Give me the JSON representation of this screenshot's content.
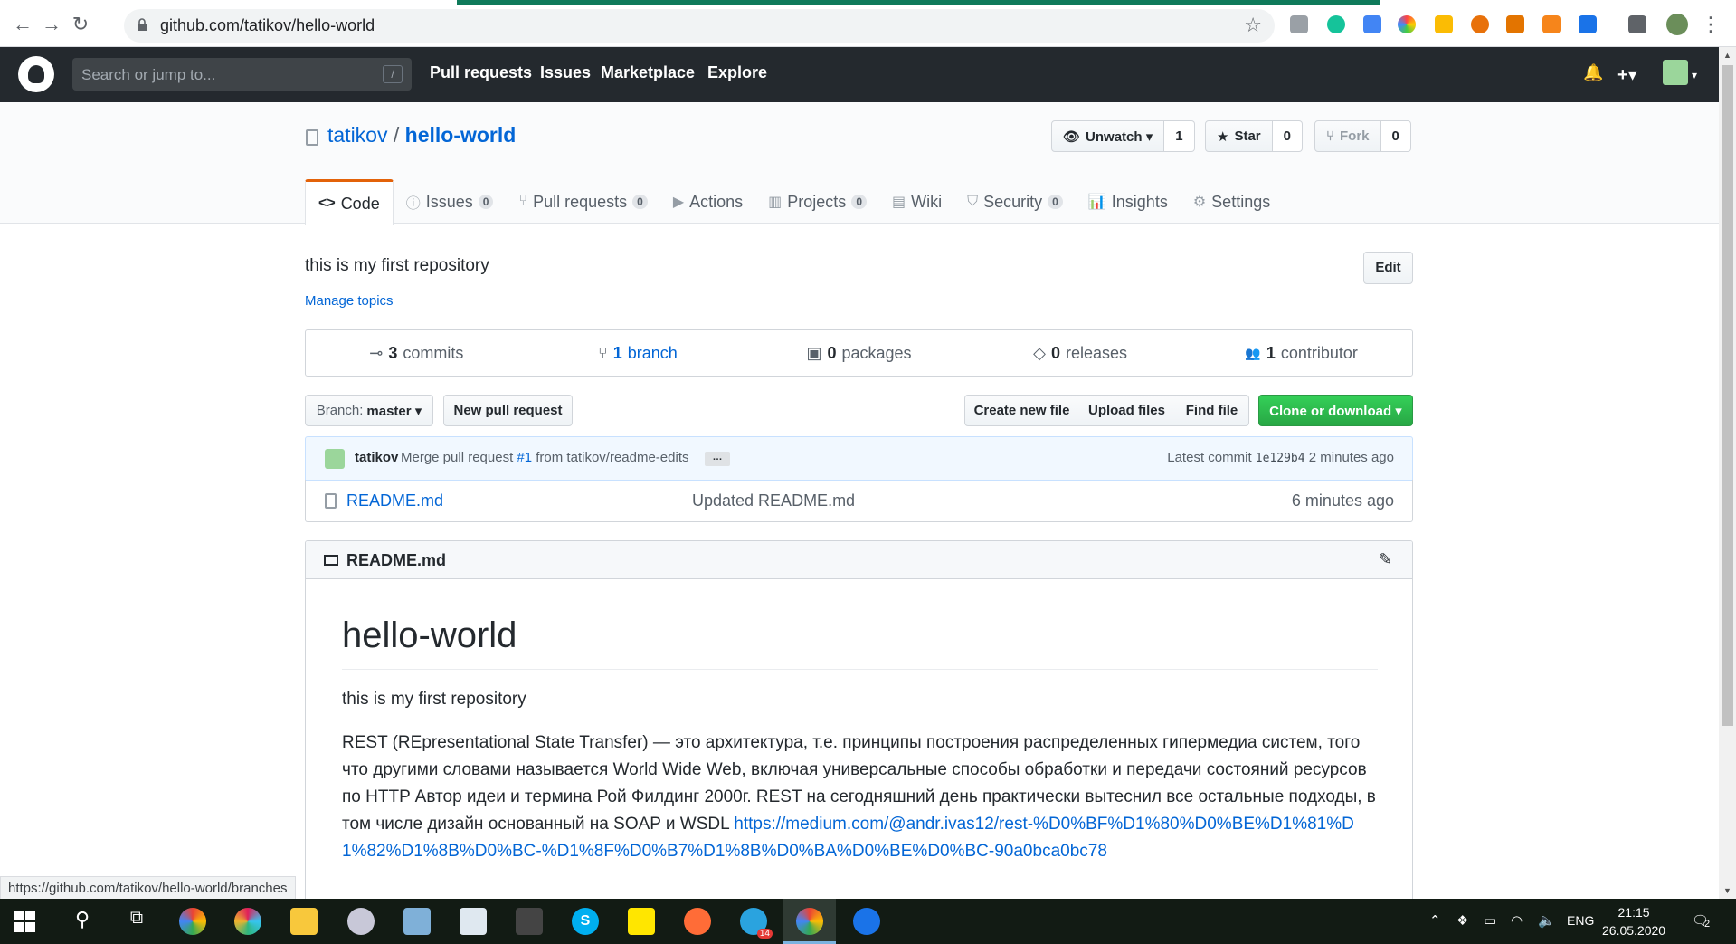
{
  "browser": {
    "url": "github.com/tatikov/hello-world",
    "back": "←",
    "forward": "→",
    "reload": "↻",
    "star": "☆"
  },
  "header": {
    "search_placeholder": "Search or jump to...",
    "search_shortcut": "/",
    "nav": [
      "Pull requests",
      "Issues",
      "Marketplace",
      "Explore"
    ],
    "bell": "🔔",
    "plus": "+▾"
  },
  "repo": {
    "owner": "tatikov",
    "separator": "/",
    "name": "hello-world",
    "watch_label": "Unwatch ▾",
    "watch_count": "1",
    "star_label": "Star",
    "star_count": "0",
    "fork_label": "Fork",
    "fork_count": "0"
  },
  "tabs": [
    {
      "label": "Code",
      "icon": "<>",
      "badge": ""
    },
    {
      "label": "Issues",
      "icon": "ⓘ",
      "badge": "0"
    },
    {
      "label": "Pull requests",
      "icon": "⑂",
      "badge": "0"
    },
    {
      "label": "Actions",
      "icon": "▶",
      "badge": ""
    },
    {
      "label": "Projects",
      "icon": "▥",
      "badge": "0"
    },
    {
      "label": "Wiki",
      "icon": "▤",
      "badge": ""
    },
    {
      "label": "Security",
      "icon": "⛉",
      "badge": "0"
    },
    {
      "label": "Insights",
      "icon": "📊",
      "badge": ""
    },
    {
      "label": "Settings",
      "icon": "⚙",
      "badge": ""
    }
  ],
  "about": {
    "description": "this is my first repository",
    "manage_topics": "Manage topics",
    "edit": "Edit"
  },
  "numbers": [
    {
      "icon": "⊸",
      "count": "3",
      "label": "commits"
    },
    {
      "icon": "⑂",
      "count": "1",
      "label": "branch"
    },
    {
      "icon": "▣",
      "count": "0",
      "label": "packages"
    },
    {
      "icon": "◇",
      "count": "0",
      "label": "releases"
    },
    {
      "icon": "👥",
      "count": "1",
      "label": "contributor"
    }
  ],
  "file_nav": {
    "branch_prefix": "Branch:",
    "branch": "master ▾",
    "new_pr": "New pull request",
    "create_file": "Create new file",
    "upload": "Upload files",
    "find": "Find file",
    "clone": "Clone or download ▾"
  },
  "commit": {
    "author": "tatikov",
    "message_prefix": "Merge pull request",
    "pr": "#1",
    "message_suffix": "from tatikov/readme-edits",
    "ellipsis": "…",
    "latest_label": "Latest commit",
    "sha": "1e129b4",
    "age": "2 minutes ago"
  },
  "files": [
    {
      "name": "README.md",
      "message": "Updated README.md",
      "age": "6 minutes ago"
    }
  ],
  "readme": {
    "title": "README.md",
    "heading": "hello-world",
    "intro": "this is my first repository",
    "body": "REST (REpresentational State Transfer) — это архитектура, т.е. принципы построения распределенных гипермедиа систем, того что другими словами называется World Wide Web, включая универсальные способы обработки и передачи состояний ресурсов по HTTP Автор идеи и термина Рой Филдинг 2000г. REST на сегодняшний день практически вытеснил все остальные подходы, в том числе дизайн основанный на SOAP и WSDL ",
    "link": "https://medium.com/@andr.ivas12/rest-%D0%BF%D1%80%D0%BE%D1%81%D1%82%D1%8B%D0%BC-%D1%8F%D0%B7%D1%8B%D0%BA%D0%BE%D0%BC-90a0bca0bc78"
  },
  "status_url": "https://github.com/tatikov/hello-world/branches",
  "taskbar": {
    "lang": "ENG",
    "time": "21:15",
    "date": "26.05.2020",
    "telegram_badge": "14",
    "notif_count": "2"
  }
}
